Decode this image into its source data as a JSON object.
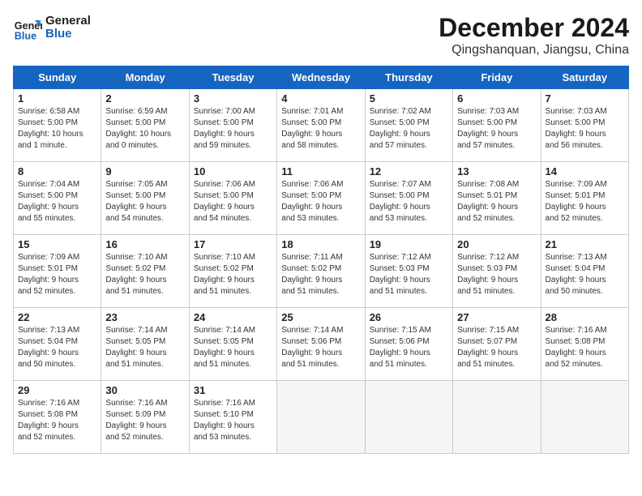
{
  "header": {
    "logo_general": "General",
    "logo_blue": "Blue",
    "month_year": "December 2024",
    "location": "Qingshanquan, Jiangsu, China"
  },
  "weekdays": [
    "Sunday",
    "Monday",
    "Tuesday",
    "Wednesday",
    "Thursday",
    "Friday",
    "Saturday"
  ],
  "weeks": [
    [
      {
        "day": "1",
        "lines": [
          "Sunrise: 6:58 AM",
          "Sunset: 5:00 PM",
          "Daylight: 10 hours",
          "and 1 minute."
        ]
      },
      {
        "day": "2",
        "lines": [
          "Sunrise: 6:59 AM",
          "Sunset: 5:00 PM",
          "Daylight: 10 hours",
          "and 0 minutes."
        ]
      },
      {
        "day": "3",
        "lines": [
          "Sunrise: 7:00 AM",
          "Sunset: 5:00 PM",
          "Daylight: 9 hours",
          "and 59 minutes."
        ]
      },
      {
        "day": "4",
        "lines": [
          "Sunrise: 7:01 AM",
          "Sunset: 5:00 PM",
          "Daylight: 9 hours",
          "and 58 minutes."
        ]
      },
      {
        "day": "5",
        "lines": [
          "Sunrise: 7:02 AM",
          "Sunset: 5:00 PM",
          "Daylight: 9 hours",
          "and 57 minutes."
        ]
      },
      {
        "day": "6",
        "lines": [
          "Sunrise: 7:03 AM",
          "Sunset: 5:00 PM",
          "Daylight: 9 hours",
          "and 57 minutes."
        ]
      },
      {
        "day": "7",
        "lines": [
          "Sunrise: 7:03 AM",
          "Sunset: 5:00 PM",
          "Daylight: 9 hours",
          "and 56 minutes."
        ]
      }
    ],
    [
      {
        "day": "8",
        "lines": [
          "Sunrise: 7:04 AM",
          "Sunset: 5:00 PM",
          "Daylight: 9 hours",
          "and 55 minutes."
        ]
      },
      {
        "day": "9",
        "lines": [
          "Sunrise: 7:05 AM",
          "Sunset: 5:00 PM",
          "Daylight: 9 hours",
          "and 54 minutes."
        ]
      },
      {
        "day": "10",
        "lines": [
          "Sunrise: 7:06 AM",
          "Sunset: 5:00 PM",
          "Daylight: 9 hours",
          "and 54 minutes."
        ]
      },
      {
        "day": "11",
        "lines": [
          "Sunrise: 7:06 AM",
          "Sunset: 5:00 PM",
          "Daylight: 9 hours",
          "and 53 minutes."
        ]
      },
      {
        "day": "12",
        "lines": [
          "Sunrise: 7:07 AM",
          "Sunset: 5:00 PM",
          "Daylight: 9 hours",
          "and 53 minutes."
        ]
      },
      {
        "day": "13",
        "lines": [
          "Sunrise: 7:08 AM",
          "Sunset: 5:01 PM",
          "Daylight: 9 hours",
          "and 52 minutes."
        ]
      },
      {
        "day": "14",
        "lines": [
          "Sunrise: 7:09 AM",
          "Sunset: 5:01 PM",
          "Daylight: 9 hours",
          "and 52 minutes."
        ]
      }
    ],
    [
      {
        "day": "15",
        "lines": [
          "Sunrise: 7:09 AM",
          "Sunset: 5:01 PM",
          "Daylight: 9 hours",
          "and 52 minutes."
        ]
      },
      {
        "day": "16",
        "lines": [
          "Sunrise: 7:10 AM",
          "Sunset: 5:02 PM",
          "Daylight: 9 hours",
          "and 51 minutes."
        ]
      },
      {
        "day": "17",
        "lines": [
          "Sunrise: 7:10 AM",
          "Sunset: 5:02 PM",
          "Daylight: 9 hours",
          "and 51 minutes."
        ]
      },
      {
        "day": "18",
        "lines": [
          "Sunrise: 7:11 AM",
          "Sunset: 5:02 PM",
          "Daylight: 9 hours",
          "and 51 minutes."
        ]
      },
      {
        "day": "19",
        "lines": [
          "Sunrise: 7:12 AM",
          "Sunset: 5:03 PM",
          "Daylight: 9 hours",
          "and 51 minutes."
        ]
      },
      {
        "day": "20",
        "lines": [
          "Sunrise: 7:12 AM",
          "Sunset: 5:03 PM",
          "Daylight: 9 hours",
          "and 51 minutes."
        ]
      },
      {
        "day": "21",
        "lines": [
          "Sunrise: 7:13 AM",
          "Sunset: 5:04 PM",
          "Daylight: 9 hours",
          "and 50 minutes."
        ]
      }
    ],
    [
      {
        "day": "22",
        "lines": [
          "Sunrise: 7:13 AM",
          "Sunset: 5:04 PM",
          "Daylight: 9 hours",
          "and 50 minutes."
        ]
      },
      {
        "day": "23",
        "lines": [
          "Sunrise: 7:14 AM",
          "Sunset: 5:05 PM",
          "Daylight: 9 hours",
          "and 51 minutes."
        ]
      },
      {
        "day": "24",
        "lines": [
          "Sunrise: 7:14 AM",
          "Sunset: 5:05 PM",
          "Daylight: 9 hours",
          "and 51 minutes."
        ]
      },
      {
        "day": "25",
        "lines": [
          "Sunrise: 7:14 AM",
          "Sunset: 5:06 PM",
          "Daylight: 9 hours",
          "and 51 minutes."
        ]
      },
      {
        "day": "26",
        "lines": [
          "Sunrise: 7:15 AM",
          "Sunset: 5:06 PM",
          "Daylight: 9 hours",
          "and 51 minutes."
        ]
      },
      {
        "day": "27",
        "lines": [
          "Sunrise: 7:15 AM",
          "Sunset: 5:07 PM",
          "Daylight: 9 hours",
          "and 51 minutes."
        ]
      },
      {
        "day": "28",
        "lines": [
          "Sunrise: 7:16 AM",
          "Sunset: 5:08 PM",
          "Daylight: 9 hours",
          "and 52 minutes."
        ]
      }
    ],
    [
      {
        "day": "29",
        "lines": [
          "Sunrise: 7:16 AM",
          "Sunset: 5:08 PM",
          "Daylight: 9 hours",
          "and 52 minutes."
        ]
      },
      {
        "day": "30",
        "lines": [
          "Sunrise: 7:16 AM",
          "Sunset: 5:09 PM",
          "Daylight: 9 hours",
          "and 52 minutes."
        ]
      },
      {
        "day": "31",
        "lines": [
          "Sunrise: 7:16 AM",
          "Sunset: 5:10 PM",
          "Daylight: 9 hours",
          "and 53 minutes."
        ]
      },
      null,
      null,
      null,
      null
    ]
  ]
}
